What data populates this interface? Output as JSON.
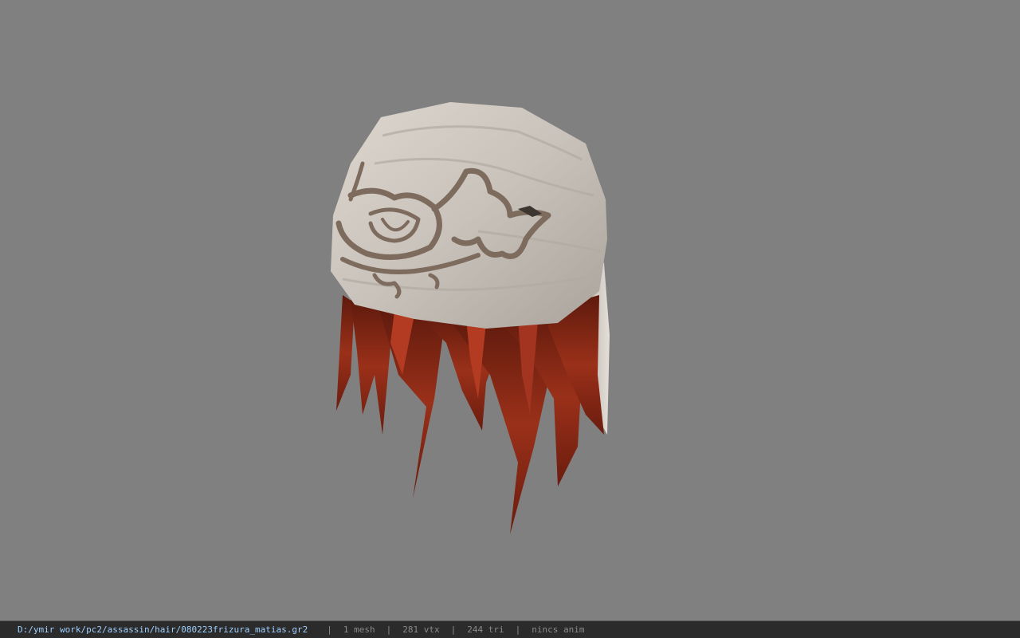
{
  "viewer": {
    "background_color": "#808080",
    "model": {
      "name": "hair-bandana-mesh",
      "bandana_color": "#c9c3bb",
      "emblem_color": "#7d6b5e",
      "hair_color": "#8e2a18"
    }
  },
  "statusbar": {
    "path": "D:/ymir work/pc2/assassin/hair/080223frizura_matias.gr2",
    "separator": "|",
    "mesh_count": "1 mesh",
    "vertex_count": "281 vtx",
    "triangle_count": "244 tri",
    "animation": "nincs anim"
  }
}
